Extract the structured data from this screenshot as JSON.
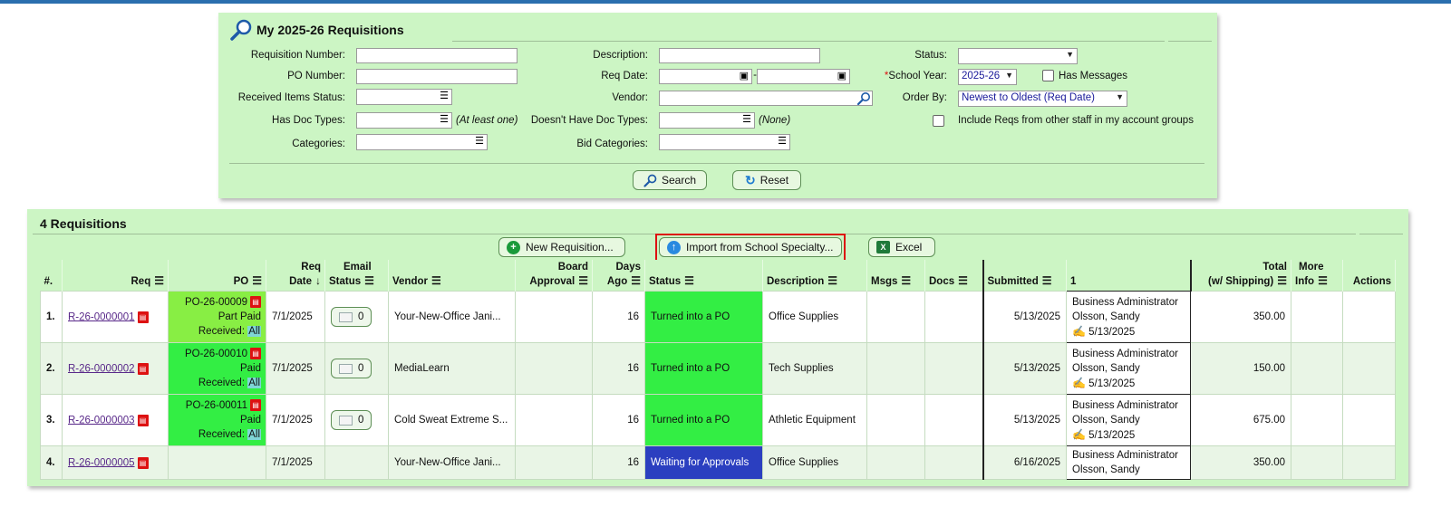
{
  "search_panel": {
    "title": "My 2025-26 Requisitions",
    "labels": {
      "req_number": "Requisition Number:",
      "po_number": "PO Number:",
      "received_status": "Received Items Status:",
      "has_doc_types": "Has Doc Types:",
      "categories": "Categories:",
      "description": "Description:",
      "req_date": "Req Date:",
      "vendor": "Vendor:",
      "doesnt_have_doc_types": "Doesn't Have Doc Types:",
      "bid_categories": "Bid Categories:",
      "status": "Status:",
      "school_year_asterisk": "*",
      "school_year": "School Year:",
      "order_by": "Order By:",
      "has_messages": "Has Messages",
      "include_reqs": "Include Reqs from other staff in my account groups"
    },
    "notes": {
      "at_least_one": "(At least one)",
      "none": "(None)",
      "date_sep": "-"
    },
    "values": {
      "school_year": "2025-26",
      "order_by": "Newest to Oldest (Req Date)",
      "status": ""
    },
    "buttons": {
      "search": "Search",
      "reset": "Reset"
    }
  },
  "results": {
    "title": "4 Requisitions",
    "buttons": {
      "new_requisition": "New Requisition...",
      "import": "Import from School Specialty...",
      "excel": "Excel"
    },
    "columns": {
      "num": "#.",
      "req": "Req",
      "po": "PO",
      "req_date_1": "Req",
      "req_date_2": "Date",
      "email_1": "Email",
      "email_2": "Status",
      "vendor": "Vendor",
      "board_1": "Board",
      "board_2": "Approval",
      "days_1": "Days",
      "days_2": "Ago",
      "status": "Status",
      "description": "Description",
      "msgs": "Msgs",
      "docs": "Docs",
      "submitted": "Submitted",
      "approver": "1",
      "total_1": "Total",
      "total_2": "(w/ Shipping)",
      "more_1": "More",
      "more_2": "Info",
      "actions": "Actions"
    },
    "rows": [
      {
        "num": "1.",
        "req": "R-26-0000001",
        "po": "PO-26-00009",
        "po_paid": "Part Paid",
        "received_label": "Received:",
        "received_value": "All",
        "req_date": "7/1/2025",
        "email_count": "0",
        "vendor": "Your-New-Office Jani...",
        "board_approval": "",
        "days_ago": "16",
        "status": "Turned into a PO",
        "description": "Office Supplies",
        "msgs": "",
        "docs": "",
        "submitted": "5/13/2025",
        "approver_title": "Business Administrator",
        "approver_name": "Olsson, Sandy",
        "approver_date": "5/13/2025",
        "total": "350.00"
      },
      {
        "num": "2.",
        "req": "R-26-0000002",
        "po": "PO-26-00010",
        "po_paid": "Paid",
        "received_label": "Received:",
        "received_value": "All",
        "req_date": "7/1/2025",
        "email_count": "0",
        "vendor": "MediaLearn",
        "board_approval": "",
        "days_ago": "16",
        "status": "Turned into a PO",
        "description": "Tech Supplies",
        "msgs": "",
        "docs": "",
        "submitted": "5/13/2025",
        "approver_title": "Business Administrator",
        "approver_name": "Olsson, Sandy",
        "approver_date": "5/13/2025",
        "total": "150.00"
      },
      {
        "num": "3.",
        "req": "R-26-0000003",
        "po": "PO-26-00011",
        "po_paid": "Paid",
        "received_label": "Received:",
        "received_value": "All",
        "req_date": "7/1/2025",
        "email_count": "0",
        "vendor": "Cold Sweat Extreme S...",
        "board_approval": "",
        "days_ago": "16",
        "status": "Turned into a PO",
        "description": "Athletic Equipment",
        "msgs": "",
        "docs": "",
        "submitted": "5/13/2025",
        "approver_title": "Business Administrator",
        "approver_name": "Olsson, Sandy",
        "approver_date": "5/13/2025",
        "total": "675.00"
      },
      {
        "num": "4.",
        "req": "R-26-0000005",
        "req_date": "7/1/2025",
        "vendor": "Your-New-Office Jani...",
        "days_ago": "16",
        "status": "Waiting for Approvals",
        "description": "Office Supplies",
        "submitted": "6/16/2025",
        "approver_title": "Business Administrator",
        "approver_name": "Olsson, Sandy",
        "total": "350.00"
      }
    ]
  },
  "icons": {
    "magnifier": "search-icon",
    "calendar": "calendar-icon",
    "list": "list-icon",
    "pdf": "pdf-icon",
    "plus": "plus-icon",
    "upload": "upload-icon",
    "excel": "excel-icon",
    "envelope": "envelope-icon",
    "refresh": "refresh-icon",
    "signature": "signature-icon",
    "filter": "filter-icon",
    "sort_down": "sort-down-icon"
  },
  "colors": {
    "panel_bg": "#ccf5c4",
    "status_po": "#33ee44",
    "status_waiting": "#2b3fc0",
    "link": "#5a2a8a"
  }
}
